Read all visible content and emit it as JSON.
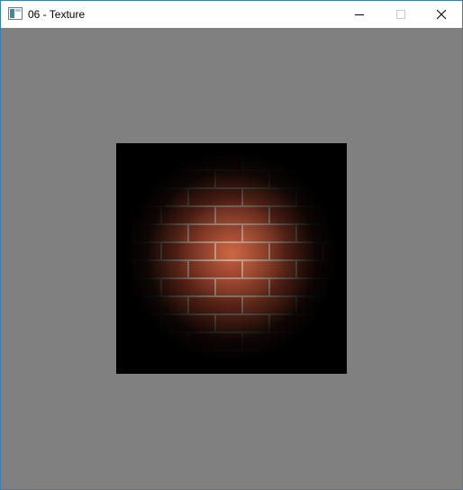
{
  "window": {
    "title": "06 - Texture",
    "icon": "application-window-icon",
    "buttons": [
      {
        "name": "minimize-button",
        "icon": "minimize-icon"
      },
      {
        "name": "maximize-button",
        "icon": "maximize-icon",
        "state": "disabled"
      },
      {
        "name": "close-button",
        "icon": "close-icon"
      }
    ]
  },
  "client": {
    "background": "#808080",
    "content": "brick-texture-quad",
    "texture": {
      "base_color": "#000000",
      "brick_color": "#b44a2e",
      "mortar_color": "#c9b0a0",
      "lighting": "spotlight-centered"
    }
  }
}
